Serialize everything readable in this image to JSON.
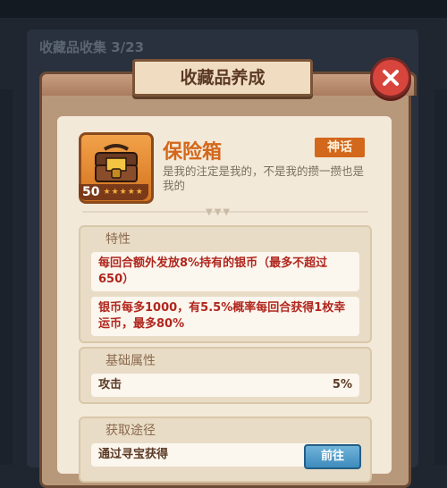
{
  "background": {
    "collection_title": "收藏品收集 3/23"
  },
  "dialog": {
    "title": "收藏品养成",
    "close_icon": "close-icon"
  },
  "item": {
    "name": "保险箱",
    "rarity": "神话",
    "level": "50",
    "stars": 5,
    "description": "是我的注定是我的，不是我的攒一攒也是我的"
  },
  "traits": {
    "title": "特性",
    "rows": [
      "每回合额外发放8%持有的银币（最多不超过650）",
      "银币每多1000，有5.5%概率每回合获得1枚幸运币，最多80%"
    ]
  },
  "base_attrs": {
    "title": "基础属性",
    "rows": [
      {
        "label": "攻击",
        "value": "5%"
      }
    ]
  },
  "obtain": {
    "title": "获取途径",
    "rows": [
      {
        "label": "通过寻宝获得",
        "button": "前往"
      }
    ]
  },
  "colors": {
    "accent": "#d3671b",
    "rarity": "#d3671b",
    "close": "#d8453c",
    "go_button": "#3e8bbd"
  }
}
